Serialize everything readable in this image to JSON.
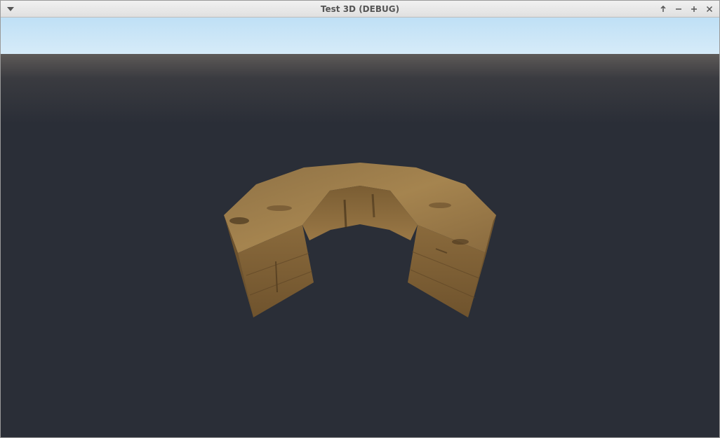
{
  "window": {
    "title": "Test 3D (DEBUG)",
    "menu_icon": "chevron-down-icon",
    "controls": [
      {
        "name": "keep-above-button",
        "icon": "arrow-up-icon"
      },
      {
        "name": "minimize-button",
        "icon": "minus-icon"
      },
      {
        "name": "maximize-button",
        "icon": "plus-icon"
      },
      {
        "name": "close-button",
        "icon": "close-icon"
      }
    ]
  },
  "scene": {
    "sky_color": "#c4e3f7",
    "ground_color": "#2a2e37",
    "object_color": "#8a6a3e"
  }
}
